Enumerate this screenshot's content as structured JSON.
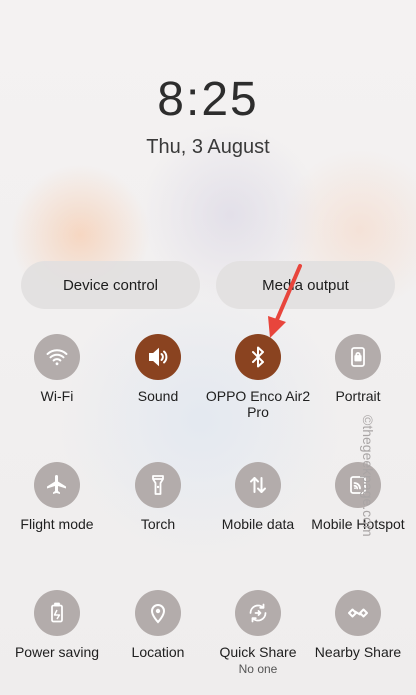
{
  "clock": {
    "time": "8:25",
    "date": "Thu, 3 August"
  },
  "pills": {
    "device_control": "Device control",
    "media_output": "Media output"
  },
  "tiles": [
    {
      "label": "Wi-Fi",
      "icon": "wifi-icon",
      "active": false
    },
    {
      "label": "Sound",
      "icon": "sound-icon",
      "active": true
    },
    {
      "label": "OPPO Enco Air2 Pro",
      "icon": "bluetooth-icon",
      "active": true
    },
    {
      "label": "Portrait",
      "icon": "portrait-lock-icon",
      "active": false
    },
    {
      "label": "Flight mode",
      "icon": "airplane-icon",
      "active": false
    },
    {
      "label": "Torch",
      "icon": "torch-icon",
      "active": false
    },
    {
      "label": "Mobile data",
      "icon": "mobile-data-icon",
      "active": false
    },
    {
      "label": "Mobile Hotspot",
      "icon": "hotspot-icon",
      "active": false
    },
    {
      "label": "Power saving",
      "icon": "battery-icon",
      "active": false
    },
    {
      "label": "Location",
      "icon": "location-icon",
      "active": false
    },
    {
      "label": "Quick Share",
      "sub": "No one",
      "icon": "quick-share-icon",
      "active": false
    },
    {
      "label": "Nearby Share",
      "icon": "nearby-share-icon",
      "active": false
    }
  ],
  "watermark": "©thegeekpage.com",
  "colors": {
    "active": "#8a4320",
    "inactive": "#b3acab",
    "annotation_arrow": "#e8453c"
  }
}
